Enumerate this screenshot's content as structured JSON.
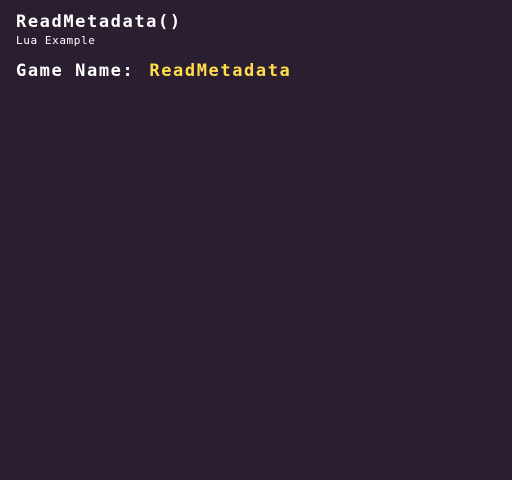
{
  "screen": {
    "title": "ReadMetadata()",
    "subtitle": "Lua Example",
    "game_name_label": "Game Name:",
    "game_name_value": "ReadMetadata"
  },
  "colors": {
    "background": "#2b1e31",
    "text": "#ffffff",
    "highlight": "#ffde4a"
  }
}
